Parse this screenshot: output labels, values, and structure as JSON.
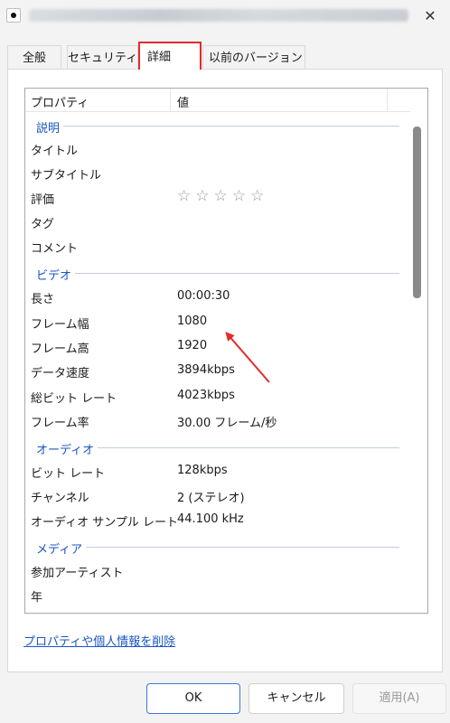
{
  "window": {
    "close_glyph": "✕"
  },
  "tabs": [
    {
      "label": "全般"
    },
    {
      "label": "セキュリティ"
    },
    {
      "label": "詳細"
    },
    {
      "label": "以前のバージョン"
    }
  ],
  "list": {
    "header_name": "プロパティ",
    "header_value": "値",
    "groups": {
      "description": "説明",
      "video": "ビデオ",
      "audio": "オーディオ",
      "media": "メディア"
    },
    "description_rows": [
      {
        "name": "タイトル",
        "value": ""
      },
      {
        "name": "サブタイトル",
        "value": ""
      },
      {
        "name": "評価",
        "value": "☆☆☆☆☆"
      },
      {
        "name": "タグ",
        "value": ""
      },
      {
        "name": "コメント",
        "value": ""
      }
    ],
    "video_rows": [
      {
        "name": "長さ",
        "value": "00:00:30"
      },
      {
        "name": "フレーム幅",
        "value": "1080"
      },
      {
        "name": "フレーム高",
        "value": "1920"
      },
      {
        "name": "データ速度",
        "value": "3894kbps"
      },
      {
        "name": "総ビット レート",
        "value": "4023kbps"
      },
      {
        "name": "フレーム率",
        "value": "30.00 フレーム/秒"
      }
    ],
    "audio_rows": [
      {
        "name": "ビット レート",
        "value": "128kbps"
      },
      {
        "name": "チャンネル",
        "value": "2 (ステレオ)"
      },
      {
        "name": "オーディオ サンプル レート",
        "value": "44.100 kHz"
      }
    ],
    "media_rows": [
      {
        "name": "参加アーティスト",
        "value": ""
      },
      {
        "name": "年",
        "value": ""
      }
    ]
  },
  "remove_link": "プロパティや個人情報を削除",
  "buttons": {
    "ok": "OK",
    "cancel": "キャンセル",
    "apply": "適用(A)"
  },
  "colors": {
    "highlight": "#e52b2b",
    "link": "#1a56c2",
    "accent_border": "#3c78d8"
  },
  "icons": {
    "app": "media-file-icon",
    "close": "close-icon",
    "rating": "star-outline-icon"
  }
}
